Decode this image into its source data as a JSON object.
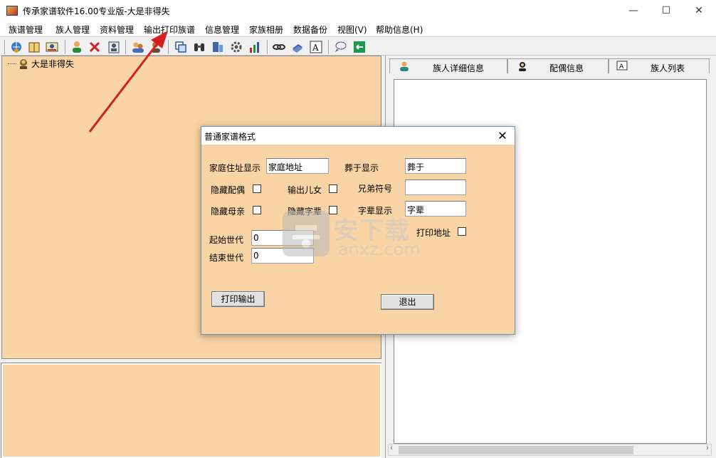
{
  "window": {
    "title": "传承家谱软件16.00专业版-大是非得失",
    "minimize_glyph": "—",
    "maximize_glyph": "☐",
    "close_glyph": "✕"
  },
  "menu": {
    "items": [
      {
        "label": "族谱管理"
      },
      {
        "label": "族人管理"
      },
      {
        "label": "资料管理"
      },
      {
        "label": "输出打印族谱"
      },
      {
        "label": "信息管理"
      },
      {
        "label": "家族相册"
      },
      {
        "label": "数据备份"
      },
      {
        "label": "视图(V)"
      },
      {
        "label": "帮助信息(H)"
      }
    ]
  },
  "toolbar": {
    "icons": [
      "globe-icon",
      "book-icon",
      "photo-icon",
      "person-icon",
      "delete-icon",
      "card-icon",
      "group-icon",
      "transfer-icon",
      "copy-icon",
      "binoculars-icon",
      "database-icon",
      "settings-icon",
      "bar-chart-icon",
      "link-icon",
      "book-stack-icon",
      "font-icon",
      "chat-icon",
      "exit-icon"
    ]
  },
  "tree": {
    "root_label": "大是非得失"
  },
  "tabs": [
    {
      "label": "族人详细信息",
      "icon": "person-icon"
    },
    {
      "label": "配偶信息",
      "icon": "spouse-icon"
    },
    {
      "label": "族人列表",
      "icon": "list-icon"
    }
  ],
  "dialog": {
    "title": "普通家谱格式",
    "close_glyph": "✕",
    "address_label": "家庭住址显示",
    "address_value": "家庭地址",
    "burial_label": "葬于显示",
    "burial_value": "葬于",
    "hide_spouse_label": "隐藏配偶",
    "output_children_label": "输出儿女",
    "brother_symbol_label": "兄弟符号",
    "brother_symbol_value": "",
    "hide_mother_label": "隐藏母亲",
    "hide_zihao_label": "隐藏字辈",
    "zihao_label": "字辈显示",
    "zihao_value": "字辈",
    "print_address_label": "打印地址",
    "start_gen_label": "起始世代",
    "start_gen_value": "0",
    "end_gen_label": "结束世代",
    "end_gen_value": "0",
    "print_button": "打印输出",
    "exit_button": "退出"
  },
  "watermark": {
    "cn": "安下载",
    "en": "anxz.com"
  },
  "colors": {
    "panel_bg": "#f9d4a4",
    "arrow": "#d42020"
  }
}
